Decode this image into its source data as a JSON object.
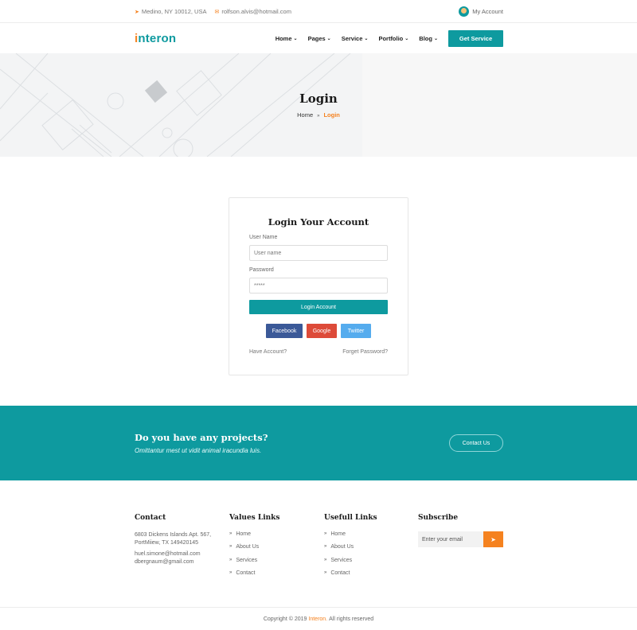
{
  "topbar": {
    "location": "Medino, NY 10012, USA",
    "email": "rolfson.alvis@hotmail.com",
    "account": "My Account"
  },
  "nav": {
    "logo_i": "i",
    "logo_rest": "nteron",
    "items": [
      "Home",
      "Pages",
      "Service",
      "Portfolio",
      "Blog"
    ],
    "cta": "Get Service"
  },
  "hero": {
    "title": "Login",
    "breadcrumb": {
      "home": "Home",
      "current": "Login"
    }
  },
  "login": {
    "title": "Login Your Account",
    "username_label": "User Name",
    "username_placeholder": "User name",
    "password_label": "Password",
    "password_value": "*****",
    "submit": "Login Account",
    "social": [
      "Facebook",
      "Google",
      "Twitter"
    ],
    "have_account": "Have Account?",
    "forget_password": "Forget Password?"
  },
  "cta": {
    "title": "Do you have any projects?",
    "subtitle": "Omittantur mest ut vidit animal iracundia luis.",
    "button": "Contact Us"
  },
  "footer": {
    "contact": {
      "title": "Contact",
      "address_line1": "6803 Dickens Islands Apt. 567,",
      "address_line2": "PortMiiew, TX 149420145",
      "email1": "huel.simone@hotmail.com",
      "email2": "dbergnaum@gmail.com"
    },
    "values_links": {
      "title": "Values Links",
      "items": [
        "Home",
        "About Us",
        "Services",
        "Contact"
      ]
    },
    "useful_links": {
      "title": "Usefull Links",
      "items": [
        "Home",
        "About Us",
        "Services",
        "Contact"
      ]
    },
    "subscribe": {
      "title": "Subscribe",
      "placeholder": "Enter your email"
    }
  },
  "copyright": {
    "prefix": "Copyright © 2019",
    "brand": "Interon.",
    "suffix": "All rights reserved"
  },
  "colors": {
    "primary": "#0e9a9f",
    "accent": "#f5821f",
    "facebook": "#3b5998",
    "google": "#dd4b39",
    "twitter": "#55acee"
  }
}
